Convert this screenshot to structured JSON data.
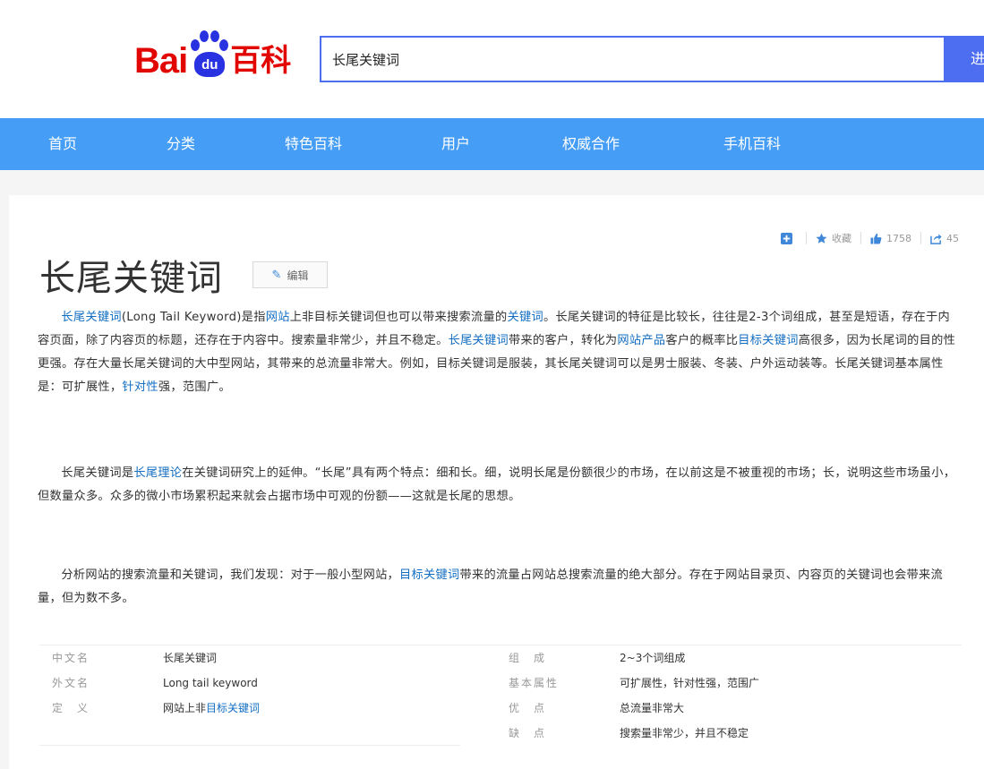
{
  "header": {
    "logo": {
      "bai": "Bai",
      "du": "du",
      "baike": "百科"
    },
    "search": {
      "value": "长尾关键词",
      "button_label": "进"
    }
  },
  "nav": {
    "items": [
      "首页",
      "分类",
      "特色百科",
      "用户",
      "权威合作",
      "手机百科"
    ]
  },
  "toolbar": {
    "collect_label": "收藏",
    "like_count": "1758",
    "share_count": "45"
  },
  "article": {
    "title": "长尾关键词",
    "edit_label": "编辑",
    "para1": {
      "link1": "长尾关键词",
      "t1": "(Long Tail Keyword)是指",
      "link2": "网站",
      "t2": "上非目标关键词但也可以带来搜索流量的",
      "link3": "关键词",
      "t3": "。长尾关键词的特征是比较长，往往是2-3个词组成，甚至是短语，存在于内容页面，除了内容页的标题，还存在于内容中。搜索量非常少，并且不稳定。",
      "link4": "长尾关键词",
      "t4": "带来的客户，转化为",
      "link5": "网站产品",
      "t5": "客户的概率比",
      "link6": "目标关键词",
      "t6": "高很多，因为长尾词的目的性更强。存在大量长尾关键词的大中型网站，其带来的总流量非常大。例如，目标关键词是服装，其长尾关键词可以是男士服装、冬装、户外运动装等。长尾关键词基本属性是：可扩展性，",
      "link7": "针对性",
      "t7": "强，范围广。"
    },
    "para2": {
      "t1": "长尾关键词是",
      "link1": "长尾理论",
      "t2": "在关键词研究上的延伸。“长尾”具有两个特点：细和长。细，说明长尾是份额很少的市场，在以前这是不被重视的市场；长，说明这些市场虽小，但数量众多。众多的微小市场累积起来就会占据市场中可观的份额——这就是长尾的思想。"
    },
    "para3": {
      "t1": "分析网站的搜索流量和关键词，我们发现：对于一般小型网站，",
      "link1": "目标关键词",
      "t2": "带来的流量占网站总搜索流量的绝大部分。存在于网站目录页、内容页的关键词也会带来流量，但为数不多。"
    }
  },
  "basic_info": {
    "left": [
      {
        "name": "中文名",
        "value": "长尾关键词"
      },
      {
        "name": "外文名",
        "value": "Long tail keyword"
      },
      {
        "name": "定　义",
        "value_text": "网站上非",
        "value_link": "目标关键词"
      }
    ],
    "right": [
      {
        "name": "组　成",
        "value": "2~3个词组成"
      },
      {
        "name": "基本属性",
        "value": "可扩展性，针对性强，范围广"
      },
      {
        "name": "优　点",
        "value": "总流量非常大"
      },
      {
        "name": "缺　点",
        "value": "搜索量非常少，并且不稳定"
      }
    ]
  }
}
